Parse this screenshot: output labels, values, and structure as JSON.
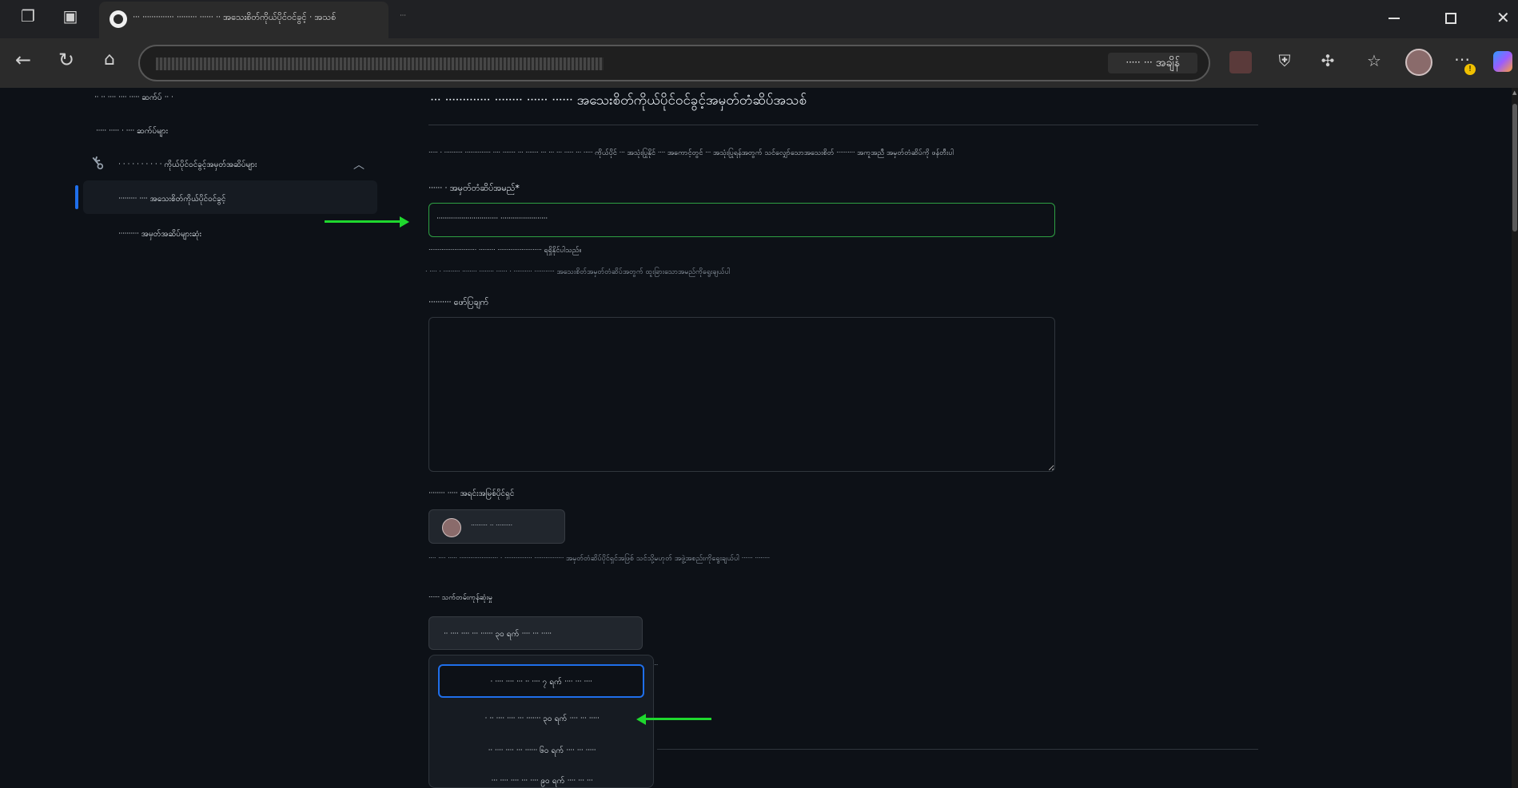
{
  "browser": {
    "active_tab_title": "ᐧᐧᐧ ᐧᐧᐧᐧᐧᐧᐧᐧᐧᐧᐧᐧᐧᐧ ᐧᐧᐧᐧᐧᐧᐧᐧᐧ ᐧᐧᐧᐧᐧᐧ ᐧᐧ အသေးစိတ်ကိုယ်ပိုင်ဝင်ခွင့် ᐧ အသစ်",
    "second_tab_title": "ᐧᐧᐧ",
    "url_tag": "ᐧᐧᐧᐧᐧ ᐧᐧᐧ အချိန်",
    "window_controls": [
      "minimize",
      "restore",
      "close"
    ]
  },
  "sidebar": {
    "items": [
      {
        "label": "ᐧᐧ ᐧᐧ ᐧᐧᐧᐧ ᐧᐧᐧᐧ ᐧᐧᐧᐧᐧ ဆက်ပ် ᐧᐧ ᐧ"
      },
      {
        "label": "ᐧᐧᐧᐧᐧ ᐧᐧᐧᐧᐧ ᐧ ᐧᐧᐧᐧ ဆက်ပ်များ"
      },
      {
        "label": "ᐧ ᐧ ᐧ ᐧ ᐧ ᐧ ᐧ ᐧ ᐧ ᐧ ကိုယ်ပိုင်ဝင်ခွင့်အမှတ်အဆိပ်များ"
      },
      {
        "label": "ᐧᐧᐧᐧᐧᐧᐧᐧᐧ ᐧᐧᐧᐧ အသေးစိတ်ကိုယ်ပိုင်ဝင်ခွင့်"
      },
      {
        "label": "ᐧᐧᐧᐧᐧᐧᐧᐧᐧᐧ အမှတ်အဆိပ်များဆုံး"
      }
    ]
  },
  "main": {
    "title": "ᐧᐧᐧ ᐧᐧᐧᐧᐧᐧᐧᐧᐧᐧᐧᐧᐧ ᐧᐧᐧᐧᐧᐧᐧᐧ ᐧᐧᐧᐧᐧᐧ ᐧᐧᐧᐧᐧᐧ အသေးစိတ်ကိုယ်ပိုင်ဝင်ခွင့်အမှတ်တံဆိပ်အသစ်",
    "intro": "ᐧᐧᐧᐧᐧ ᐧ ᐧᐧᐧᐧᐧᐧᐧᐧᐧᐧ ᐧᐧᐧᐧᐧᐧᐧᐧᐧᐧᐧᐧᐧᐧ ᐧᐧᐧᐧ ᐧᐧᐧᐧᐧᐧᐧ ᐧᐧᐧ ᐧᐧᐧᐧᐧᐧᐧ ᐧᐧᐧ ᐧᐧᐧ ᐧᐧᐧ ᐧᐧᐧᐧᐧ ᐧᐧᐧ ᐧᐧᐧᐧᐧ ကိုယ်ပိုင် ᐧᐧᐧ အသုံးပြုနိုင် ᐧᐧᐧᐧ အကောင့်တွင် ᐧᐧᐧ အသုံးပြုရန်အတွက် သင်လျှော်သောအသေးစိတ် ᐧᐧᐧᐧᐧᐧᐧᐧᐧᐧ အကူအညီ အမှတ်တံဆိပ်ကို ဖန်တီးပါ",
    "token_name_label": "ᐧᐧᐧᐧᐧᐧ ᐧ အမှတ်တံဆိပ်အမည်",
    "token_name_required": "*",
    "token_name_value": "ᐧᐧᐧᐧᐧᐧᐧᐧᐧᐧᐧᐧᐧᐧᐧᐧᐧᐧᐧᐧᐧᐧᐧᐧᐧᐧᐧᐧᐧᐧ ᐧᐧᐧᐧᐧᐧᐧᐧᐧᐧᐧᐧᐧᐧᐧᐧᐧᐧᐧᐧᐧᐧᐧ",
    "token_name_valid": "ᐧᐧᐧᐧᐧᐧᐧᐧᐧᐧᐧᐧᐧᐧᐧᐧᐧᐧᐧᐧᐧᐧᐧᐧᐧᐧ ᐧᐧᐧᐧᐧᐧᐧᐧᐧ ᐧᐧᐧᐧᐧᐧᐧᐧᐧᐧᐧᐧᐧᐧᐧᐧᐧᐧᐧᐧᐧᐧᐧᐧ ရရှိနိုင်ပါသည်။",
    "token_name_help": "ᐧ ᐧᐧᐧᐧ ᐧ ᐧᐧᐧᐧᐧᐧᐧᐧᐧ ᐧᐧᐧᐧᐧᐧᐧᐧ ᐧᐧᐧᐧᐧᐧᐧᐧ ᐧᐧᐧᐧᐧᐧ ᐧ ᐧᐧᐧᐧᐧᐧᐧᐧᐧᐧ ᐧᐧᐧᐧᐧᐧᐧᐧᐧᐧᐧ အသေးစိတ်အမှတ်တံဆိပ်အတွက် ထူးခြားသောအမည်ကိုရွေးချယ်ပါ",
    "description_label": "ᐧᐧᐧᐧᐧᐧᐧᐧᐧᐧ ဖော်ပြချက်",
    "description_value": "",
    "owner_label": "ᐧᐧᐧᐧᐧᐧᐧᐧ ᐧᐧᐧᐧᐧ အရင်းအမြစ်ပိုင်ရှင်",
    "owner_button_label": "ᐧᐧᐧᐧᐧᐧᐧᐧᐧ ᐧᐧ ᐧᐧᐧᐧᐧᐧᐧᐧᐧ",
    "owner_help": "ᐧᐧᐧᐧ ᐧᐧᐧᐧ ᐧᐧᐧᐧᐧ ᐧᐧᐧᐧᐧᐧᐧᐧᐧᐧᐧᐧᐧᐧᐧᐧᐧᐧᐧᐧᐧ ᐧ ᐧᐧᐧᐧᐧᐧᐧᐧᐧᐧᐧᐧᐧᐧᐧ ᐧᐧᐧᐧᐧᐧᐧᐧᐧᐧᐧᐧᐧᐧᐧᐧ အမှတ်တံဆိပ်ပိုင်ရှင်အဖြစ် သင်သို့မဟုတ် အဖွဲ့အစည်းကိုရွေးချယ်ပါ ᐧᐧᐧᐧᐧᐧ ᐧᐧᐧᐧᐧᐧᐧᐧ",
    "expiration_label": "ᐧᐧᐧᐧᐧᐧ သက်တမ်းကုန်ဆုံးမှု",
    "expiration_selected": "ᐧᐧ ᐧᐧᐧᐧ ᐧᐧᐧᐧ ᐧᐧᐧ ᐧᐧᐧᐧᐧᐧ ၃၀ ရက် ᐧᐧᐧᐧ ᐧᐧᐧ ᐧᐧᐧᐧᐧ",
    "expiration_suffix": "ᐧᐧᐧ",
    "expiration_options": [
      {
        "label": "ᐧ ᐧᐧᐧᐧ ᐧᐧᐧᐧ ᐧᐧᐧ ᐧᐧ ᐧᐧᐧᐧ ၇ ရက် ᐧᐧᐧᐧ ᐧᐧᐧ ᐧᐧᐧᐧ"
      },
      {
        "label": "ᐧ ᐧᐧ ᐧᐧᐧᐧ ᐧᐧᐧᐧ ᐧᐧᐧ ᐧᐧᐧᐧᐧᐧᐧ ၃၀ ရက် ᐧᐧᐧᐧ ᐧᐧᐧ ᐧᐧᐧᐧᐧ"
      },
      {
        "label": "ᐧᐧ ᐧᐧᐧᐧ ᐧᐧᐧᐧ ᐧᐧᐧ ᐧᐧᐧᐧᐧᐧ ၆၀ ရက် ᐧᐧᐧᐧ ᐧᐧᐧ ᐧᐧᐧᐧᐧ"
      },
      {
        "label": "ᐧᐧᐧ ᐧᐧᐧᐧ ᐧᐧᐧᐧ ᐧᐧᐧ ᐧᐧᐧᐧ ၉၀ ရက် ᐧᐧᐧᐧ ᐧᐧᐧ ᐧᐧᐧ"
      }
    ]
  },
  "colors": {
    "accent_blue": "#1f6feb",
    "valid_green": "#2ea043",
    "annotation_arrow": "#1fd82e"
  }
}
